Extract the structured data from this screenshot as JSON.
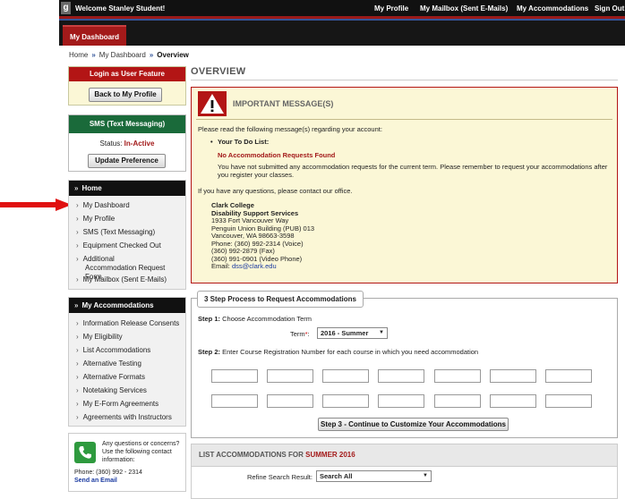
{
  "topbar": {
    "logo_glyph": "g",
    "welcome": "Welcome Stanley Student!",
    "nav": [
      "My Profile",
      "My Mailbox (Sent E-Mails)",
      "My Accommodations",
      "Sign Out"
    ]
  },
  "tabs": {
    "active": "My Dashboard"
  },
  "breadcrumb": {
    "home": "Home",
    "dashboard": "My Dashboard",
    "current": "Overview",
    "separator": "»"
  },
  "login_box": {
    "title": "Login as User Feature",
    "button": "Back to My Profile"
  },
  "sms_box": {
    "title": "SMS (Text Messaging)",
    "status_label": "Status:",
    "status_value": "In-Active",
    "button": "Update Preference"
  },
  "home_menu": {
    "title": "Home",
    "items": [
      "My Dashboard",
      "My Profile",
      "SMS (Text Messaging)",
      "Equipment Checked Out",
      "Additional Accommodation Request Form",
      "My Mailbox (Sent E-Mails)"
    ]
  },
  "accommodations_menu": {
    "title": "My Accommodations",
    "items": [
      "Information Release Consents",
      "My Eligibility",
      "List Accommodations",
      "Alternative Testing",
      "Alternative Formats",
      "Notetaking Services",
      "My E-Form Agreements",
      "Agreements with Instructors"
    ]
  },
  "contact_box": {
    "text": "Any questions or concerns? Use the following contact information:",
    "phone": "Phone: (360) 992 - 2314",
    "email_link": "Send an Email"
  },
  "main": {
    "title": "OVERVIEW",
    "important": {
      "title": "IMPORTANT MESSAGE(S)",
      "intro": "Please read the following message(s) regarding your account:",
      "todo": "Your To Do List:",
      "no_requests": "No Accommodation Requests Found",
      "desc": "You have not submitted any accommodation requests for the current term. Please remember to request your accommodations after you register your classes.",
      "contact_line": "If you have any questions, please contact our office.",
      "address": {
        "college": "Clark College",
        "dept": "Disability Support Services",
        "street": "1933 Fort Vancouver Way",
        "building": "Penguin Union Building (PUB) 013",
        "city": "Vancouver, WA 98663-3598",
        "phone": "Phone: (360) 992-2314 (Voice)",
        "fax": "(360) 992-2879 (Fax)",
        "video": "(360) 991-0901 (Video Phone)",
        "email_label": "Email:",
        "email": "dss@clark.edu"
      }
    },
    "steps": {
      "legend": "3 Step Process to Request Accommodations",
      "step1_label": "Step 1:",
      "step1_text": "Choose Accommodation Term",
      "term_label": "Term",
      "term_required": "*",
      "term_colon": ":",
      "term_value": "2016 - Summer",
      "step2_label": "Step 2:",
      "step2_text": "Enter Course Registration Number for each course in which you need accommodation",
      "continue_button": "Step 3 - Continue to Customize Your Accommodations"
    },
    "list": {
      "title_prefix": "LIST ACCOMMODATIONS FOR",
      "title_term": "SUMMER 2016",
      "refine_label": "Refine Search Result:",
      "refine_value": "Search All"
    }
  }
}
